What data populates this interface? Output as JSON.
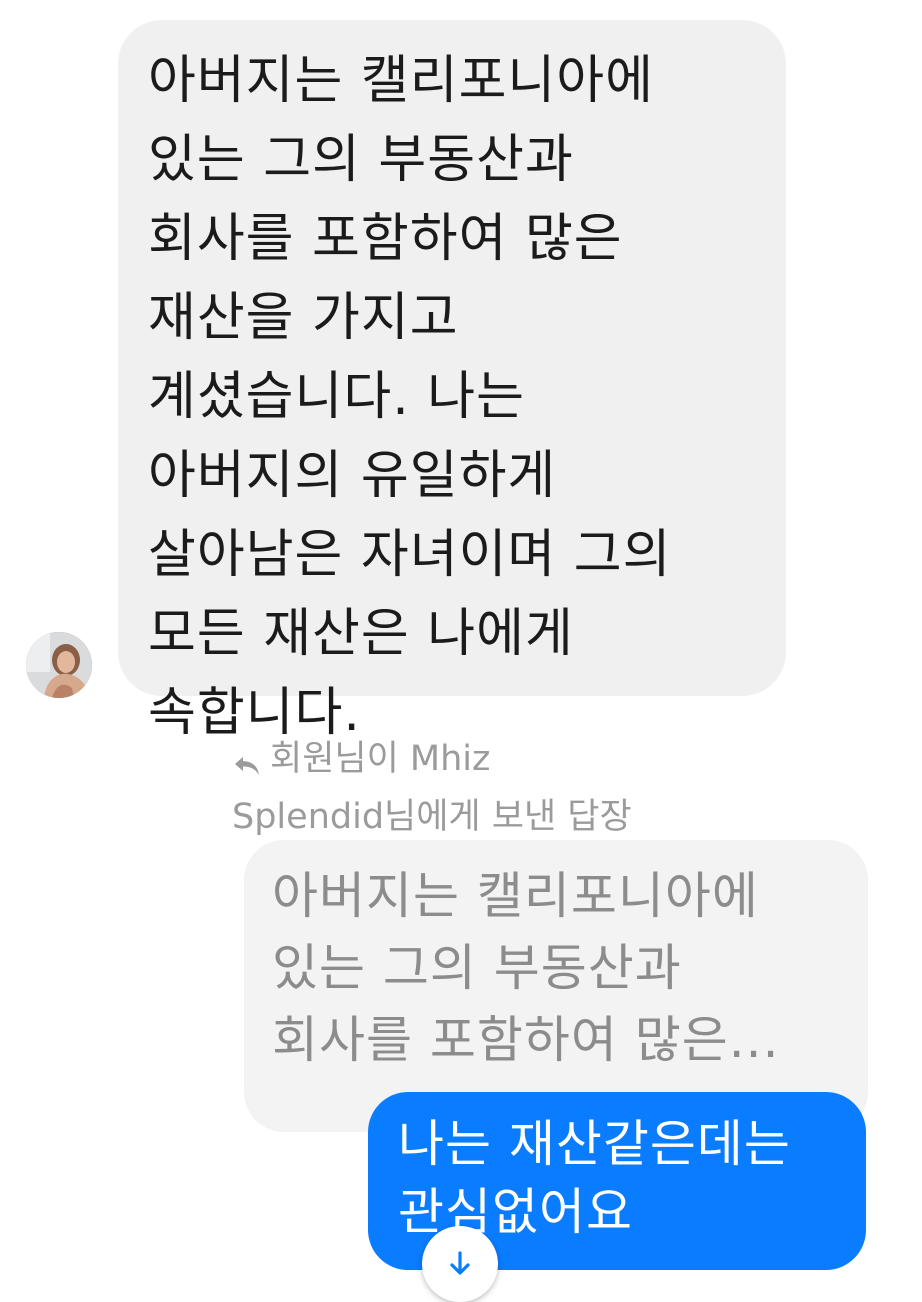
{
  "received_message": {
    "lines": [
      "아버지는 캘리포니아에",
      "있는 그의 부동산과",
      "회사를 포함하여 많은",
      "재산을 가지고",
      "계셨습니다.  나는",
      "아버지의 유일하게",
      "살아남은 자녀이며 그의",
      "모든 재산은 나에게",
      "속합니다."
    ]
  },
  "reply_context": {
    "line1": "회원님이 Mhiz",
    "line2": "Splendid님에게 보낸 답장"
  },
  "quoted_message": {
    "lines": [
      "아버지는 캘리포니아에",
      "있는 그의 부동산과",
      "회사를 포함하여 많은..."
    ]
  },
  "sent_message": {
    "lines": [
      "나는 재산같은데는",
      "관심없어요"
    ]
  },
  "icons": {
    "reply": "reply-arrow-icon",
    "scroll_down": "arrow-down-icon"
  },
  "colors": {
    "sent_bubble": "#0a7cff",
    "received_bubble": "#f0f0f0",
    "quoted_text": "#8c8c8c",
    "meta_text": "#9b9b9b",
    "scroll_arrow": "#0a7cff"
  }
}
